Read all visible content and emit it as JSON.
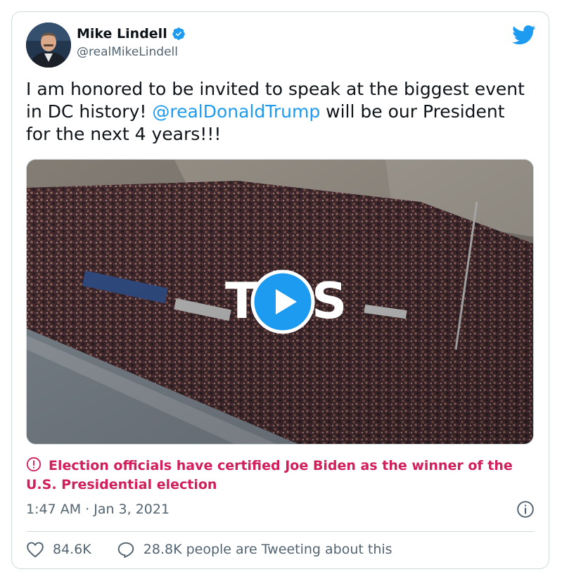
{
  "author": {
    "name": "Mike Lindell",
    "handle": "@realMikeLindell"
  },
  "tweet": {
    "text_before": "I am honored to be invited to speak at the biggest event in DC history! ",
    "mention": "@realDonaldTrump",
    "text_after": " will be our President for the next 4 years!!!"
  },
  "media": {
    "overlay_text_left": "T",
    "overlay_text_right": "S"
  },
  "warning": {
    "text": "Election officials have certified Joe Biden as the winner of the U.S. Presidential election"
  },
  "timestamp": "1:47 AM · Jan 3, 2021",
  "actions": {
    "likes": "84.6K",
    "tweeting": "28.8K people are Tweeting about this"
  },
  "colors": {
    "accent": "#1d9bf0",
    "warning": "#d21e5a",
    "muted": "#536471"
  },
  "icons": [
    "verified-badge-icon",
    "twitter-bird-icon",
    "play-icon",
    "warning-icon",
    "info-icon",
    "heart-icon",
    "reply-bubble-icon"
  ]
}
